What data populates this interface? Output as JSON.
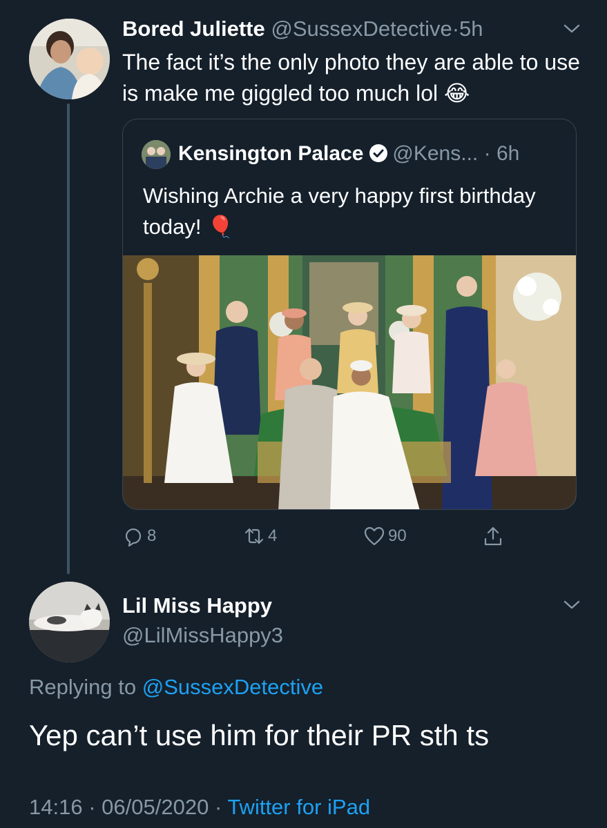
{
  "tweet1": {
    "name": "Bored Juliette",
    "handle": "@SussexDetective",
    "separator": "·",
    "time": "5h",
    "text": "The fact it’s the only photo they are able to use is make me giggled too much lol",
    "emoji": "😂",
    "quoted": {
      "name": "Kensington Palace",
      "handle": "@Kens...",
      "separator": "·",
      "time": "6h",
      "text": "Wishing Archie a very happy first birthday today!",
      "emoji": "🎈"
    },
    "actions": {
      "replies": "8",
      "retweets": "4",
      "likes": "90"
    }
  },
  "tweet2": {
    "name": "Lil Miss Happy",
    "handle": "@LilMissHappy3",
    "replying_prefix": "Replying to",
    "replying_to": "@SussexDetective",
    "text": "Yep can’t use him for their PR sth ts",
    "time": "14:16",
    "separator": "·",
    "date": "06/05/2020",
    "source": "Twitter for iPad"
  },
  "colors": {
    "background": "#15202b",
    "muted": "#8899a6",
    "link": "#1da1f2",
    "border": "#38444d"
  }
}
